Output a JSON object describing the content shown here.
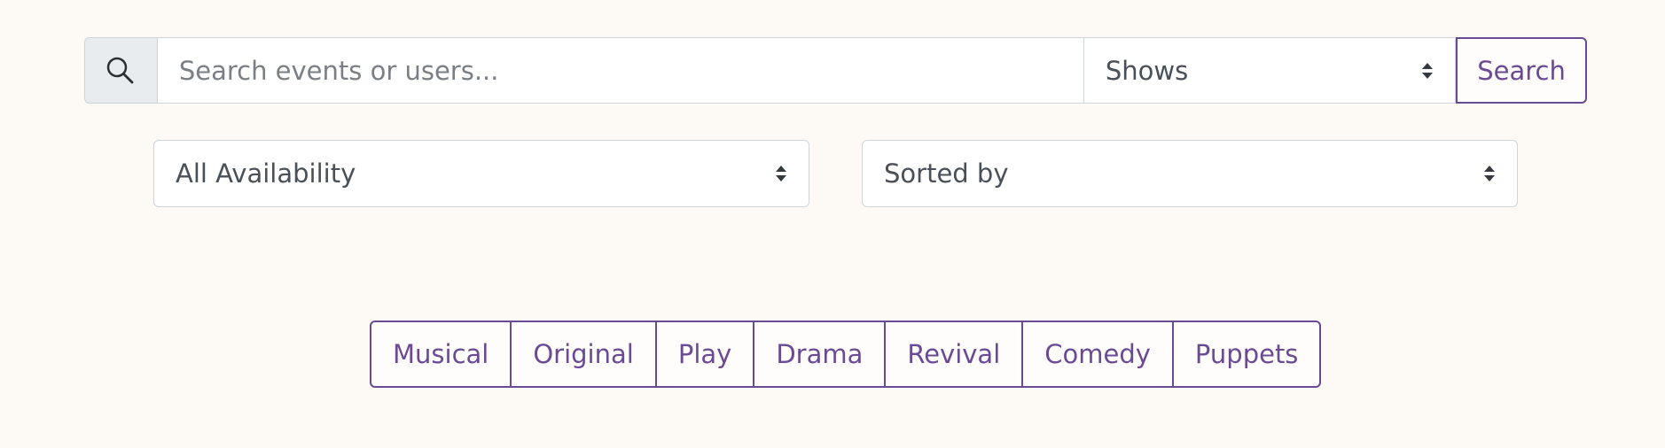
{
  "search": {
    "icon": "search-icon",
    "placeholder": "Search events or users...",
    "value": "",
    "category": "Shows",
    "button_label": "Search"
  },
  "filters": {
    "availability": "All Availability",
    "sort": "Sorted by"
  },
  "genres": [
    "Musical",
    "Original",
    "Play",
    "Drama",
    "Revival",
    "Comedy",
    "Puppets"
  ],
  "colors": {
    "background": "#fdf9f5",
    "accent": "#6a4a93",
    "border": "#ced4da",
    "addon": "#e9ecef",
    "text": "#495057"
  }
}
